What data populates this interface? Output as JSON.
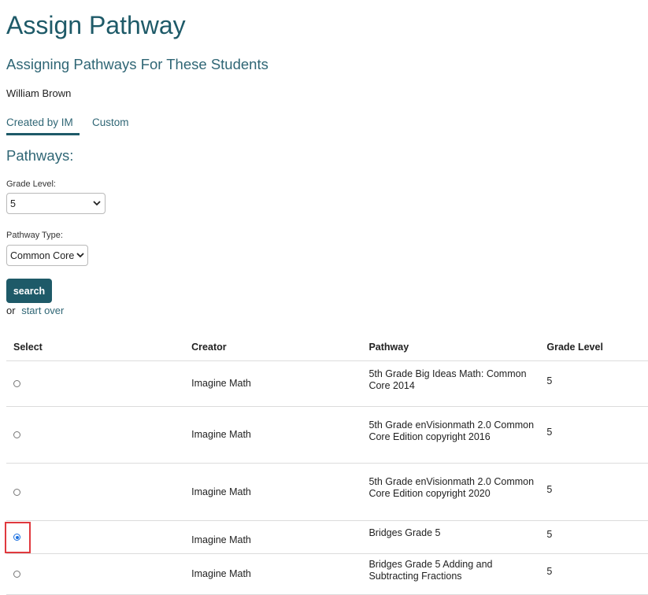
{
  "page": {
    "title": "Assign Pathway",
    "section_title": "Assigning Pathways For These Students",
    "student_name": "William Brown"
  },
  "tabs": [
    {
      "label": "Created by IM",
      "active": true
    },
    {
      "label": "Custom",
      "active": false
    }
  ],
  "filters": {
    "title": "Pathways:",
    "grade_level_label": "Grade Level:",
    "grade_level_value": "5",
    "pathway_type_label": "Pathway Type:",
    "pathway_type_value": "Common Core",
    "search_label": "search",
    "or_text": "or",
    "start_over_label": "start over"
  },
  "table": {
    "headers": [
      "Select",
      "Creator",
      "Pathway",
      "Grade Level"
    ],
    "rows": [
      {
        "selected": false,
        "creator": "Imagine Math",
        "pathway": "5th Grade Big Ideas Math: Common Core 2014",
        "grade": "5"
      },
      {
        "selected": false,
        "creator": "Imagine Math",
        "pathway": "5th Grade enVisionmath 2.0 Common Core Edition copyright 2016",
        "grade": "5"
      },
      {
        "selected": false,
        "creator": "Imagine Math",
        "pathway": "5th Grade enVisionmath 2.0 Common Core Edition copyright 2020",
        "grade": "5"
      },
      {
        "selected": true,
        "creator": "Imagine Math",
        "pathway": "Bridges Grade 5",
        "grade": "5"
      },
      {
        "selected": false,
        "creator": "Imagine Math",
        "pathway": "Bridges Grade 5 Adding and Subtracting Fractions",
        "grade": "5"
      }
    ]
  },
  "colors": {
    "accent": "#1e5a68",
    "link": "#2f6675",
    "highlight": "#e0393e",
    "radio_selected": "#1a6fe0"
  },
  "icons": {
    "select_chevron": "chevron-down-icon"
  }
}
